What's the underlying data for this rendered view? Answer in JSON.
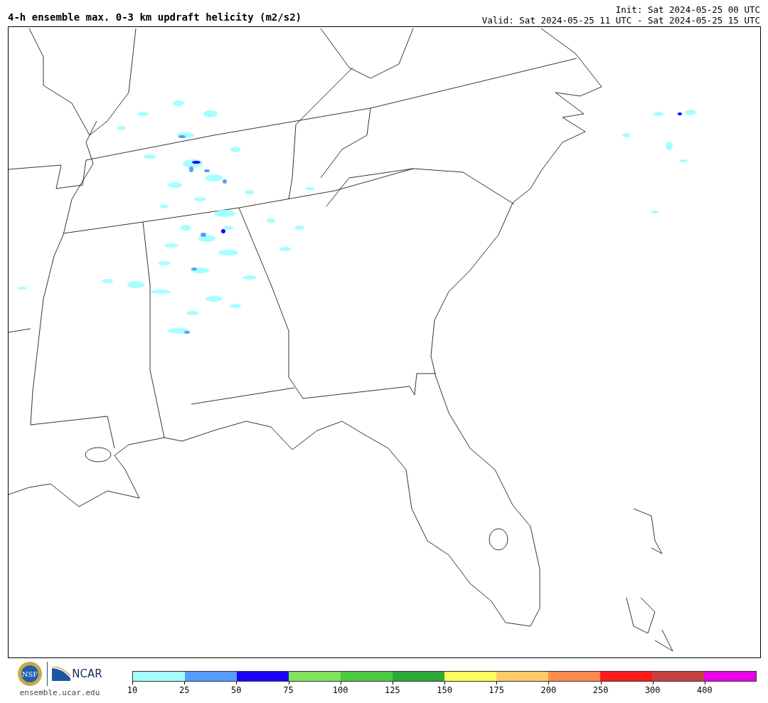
{
  "title": "4-h ensemble max. 0-3 km updraft helicity (m2/s2)",
  "init": "Init: Sat 2024-05-25 00 UTC",
  "valid": "Valid: Sat 2024-05-25 11 UTC - Sat 2024-05-25 15 UTC",
  "logos": {
    "nsf": "NSF",
    "ncar": "NCAR",
    "url": "ensemble.ucar.edu"
  },
  "colorbar": {
    "segments": [
      {
        "color": "#a5fffe",
        "label": "10"
      },
      {
        "color": "#559cff",
        "label": "25"
      },
      {
        "color": "#1a00ff",
        "label": "50"
      },
      {
        "color": "#80e35b",
        "label": "75"
      },
      {
        "color": "#4ec943",
        "label": "100"
      },
      {
        "color": "#2ea836",
        "label": "125"
      },
      {
        "color": "#fefc5c",
        "label": "150"
      },
      {
        "color": "#fecb66",
        "label": "175"
      },
      {
        "color": "#fe8b4e",
        "label": "200"
      },
      {
        "color": "#fe1b1b",
        "label": "250"
      },
      {
        "color": "#c84040",
        "label": "300"
      },
      {
        "color": "#e800e8",
        "label": "400"
      }
    ]
  }
}
